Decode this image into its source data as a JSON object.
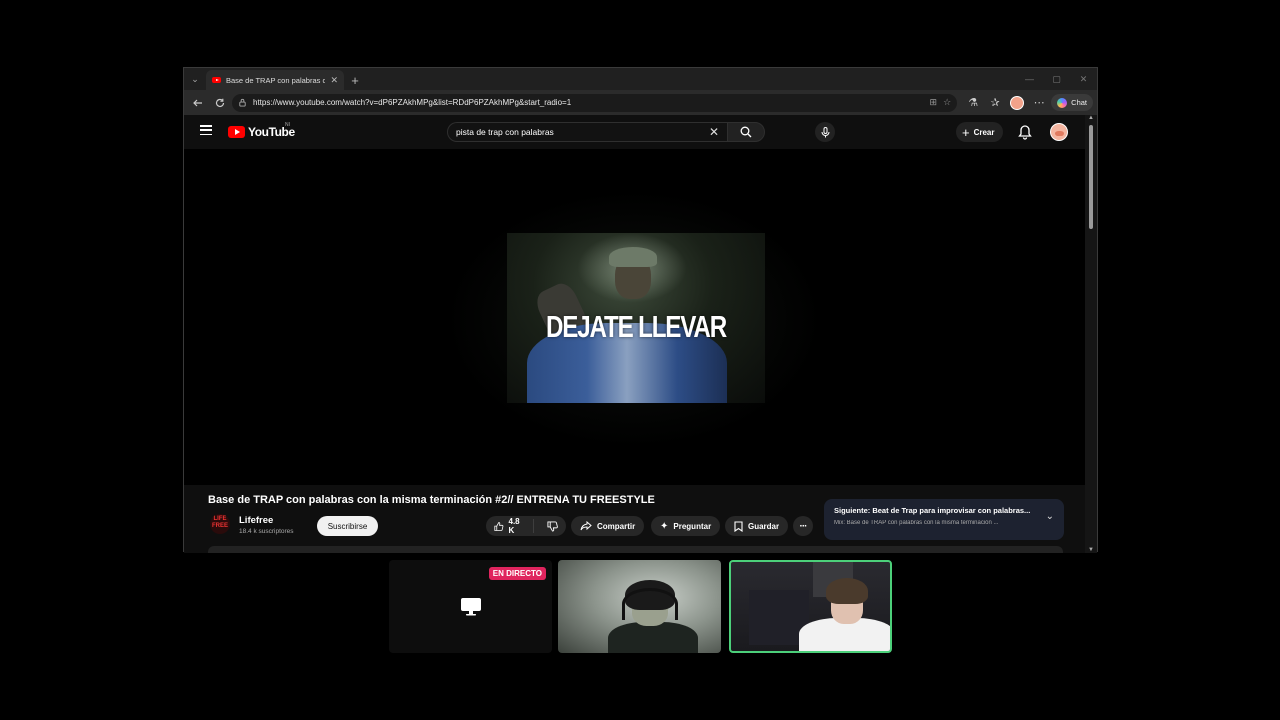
{
  "browser": {
    "tab": {
      "title": "Base de TRAP con palabras con la misma terminación",
      "close": "✕"
    },
    "new_tab": "+",
    "window_controls": {
      "minimize": "—",
      "maximize": "▢",
      "close": "✕"
    },
    "url": "https://www.youtube.com/watch?v=dP6PZAkhMPg&list=RDdP6PZAkhMPg&start_radio=1",
    "copilot_label": "Chat"
  },
  "youtube": {
    "logo_text": "YouTube",
    "region": "NI",
    "search": {
      "query": "pista de trap con palabras"
    },
    "create_label": "Crear",
    "thumbnail_text": "DEJATE LLEVAR",
    "video_title": "Base de TRAP con palabras con la misma terminación #2// ENTRENA TU FREESTYLE",
    "channel": {
      "name": "Lifefree",
      "subscribers": "18.4 k suscriptores",
      "avatar_text": "LIFE FREE"
    },
    "subscribe_label": "Suscribirse",
    "likes": "4.8 K",
    "share_label": "Compartir",
    "ask_label": "Preguntar",
    "save_label": "Guardar",
    "playlist": {
      "next": "Siguiente: Beat de Trap para improvisar con palabras...",
      "mix": "Mix: Base de TRAP con palabras con la misma terminación ..."
    }
  },
  "participants": {
    "live_badge": "EN DIRECTO",
    "accent_color": "#4cd07a",
    "live_color": "#e0245e"
  },
  "colors": {
    "youtube_red": "#ff0000",
    "page_bg": "#0f0f0f"
  }
}
